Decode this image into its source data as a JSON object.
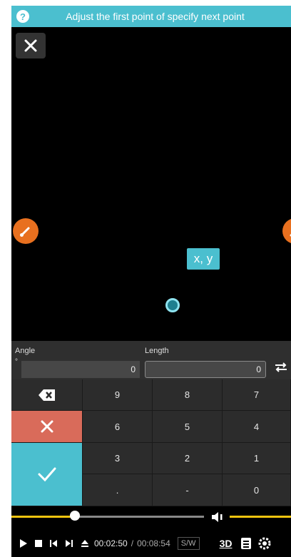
{
  "header": {
    "instruction": "Adjust the first point of specify next point",
    "help_glyph": "?"
  },
  "canvas": {
    "coord_label": "x, y"
  },
  "inputs": {
    "angle_label": "Angle",
    "length_label": "Length",
    "degree_symbol": "°",
    "angle_value": "0",
    "length_value": "0"
  },
  "keypad": {
    "keys": [
      "9",
      "8",
      "7",
      "6",
      "5",
      "4",
      "3",
      "2",
      "1",
      ".",
      "-",
      "0"
    ]
  },
  "media": {
    "progress": 0.33,
    "volume": 0.8,
    "time_current": "00:02:50",
    "time_separator": "/",
    "time_total": "00:08:54",
    "sw_label": "S/W",
    "three_d_label": "3D"
  },
  "colors": {
    "accent": "#4bbfcf",
    "cancel": "#d96b5a",
    "orange": "#e8701f",
    "seek": "#f2c40f"
  }
}
